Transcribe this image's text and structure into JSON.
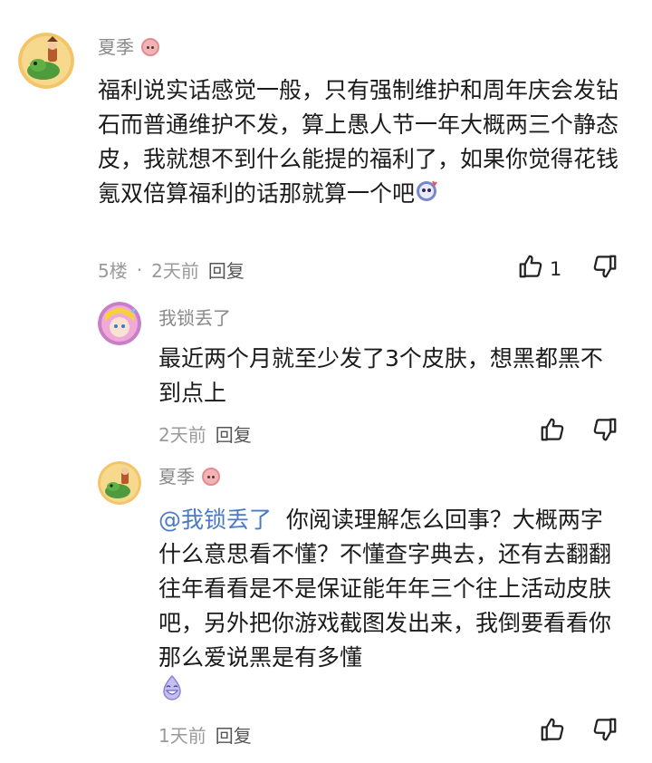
{
  "comments": [
    {
      "author": "夏季",
      "text_parts": [
        "福利说实话感觉一般，只有强制维护和周年庆会发钻石而普通维护不发，算上愚人节一年大概两三个静态皮，我就想不到什么能提的福利了，如果你觉得花钱氪双倍算福利的话那就算一个吧"
      ],
      "floor": "5楼",
      "dot": "·",
      "time": "2天前",
      "reply_label": "回复",
      "like_count": "1"
    },
    {
      "author": "我锁丢了",
      "text": "最近两个月就至少发了3个皮肤，想黑都黑不到点上",
      "time": "2天前",
      "reply_label": "回复"
    },
    {
      "author": "夏季",
      "mention": "@我锁丢了",
      "text": "你阅读理解怎么回事？大概两字什么意思看不懂？不懂查字典去，还有去翻翻往年看看是不是保证能年年三个往上活动皮肤吧，另外把你游戏截图发出来，我倒要看看你那么爱说黑是有多懂",
      "time": "1天前",
      "reply_label": "回复"
    }
  ]
}
